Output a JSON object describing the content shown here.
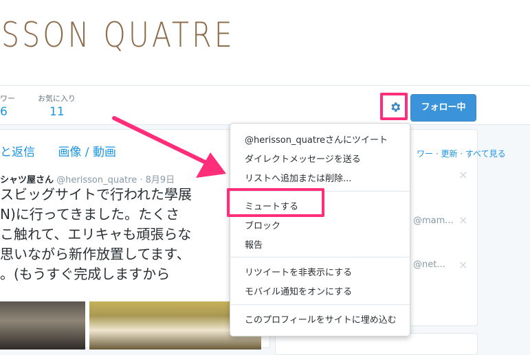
{
  "header": {
    "logo_text": "SSON QUATRE"
  },
  "stats": [
    {
      "label": "ワー",
      "value": "6"
    },
    {
      "label": "お気に入り",
      "value": "11"
    }
  ],
  "actions": {
    "follow_label": "フォロー中"
  },
  "timeline": {
    "tabs": [
      "と返信",
      "画像 / 動画"
    ],
    "tweet": {
      "name": "シャツ屋さん",
      "handle": "@herisson_quatre",
      "date": "· 8月9日",
      "lines": [
        "スビッグサイトで行われた學展",
        "N)に行ってきました。たくさ",
        "こ触れて、エリキャも頑張らな",
        "思いながら新作放置してます、",
        "。(もうすぐ完成しますから"
      ]
    }
  },
  "sidebar": {
    "header": "ワー · 更新 · すべて見る",
    "rows": [
      "@mam...",
      "@net..."
    ]
  },
  "dropdown": {
    "items": [
      "@herisson_quatreさんにツイート",
      "ダイレクトメッセージを送る",
      "リストへ追加または削除...",
      "ミュートする",
      "ブロック",
      "報告",
      "リツイートを非表示にする",
      "モバイル通知をオンにする",
      "このプロフィールをサイトに埋め込む"
    ]
  },
  "colors": {
    "accent": "#1b95e0",
    "highlight": "#ff2d7a",
    "logo": "#8c6a4a",
    "follow_bg": "#3b94d9"
  }
}
